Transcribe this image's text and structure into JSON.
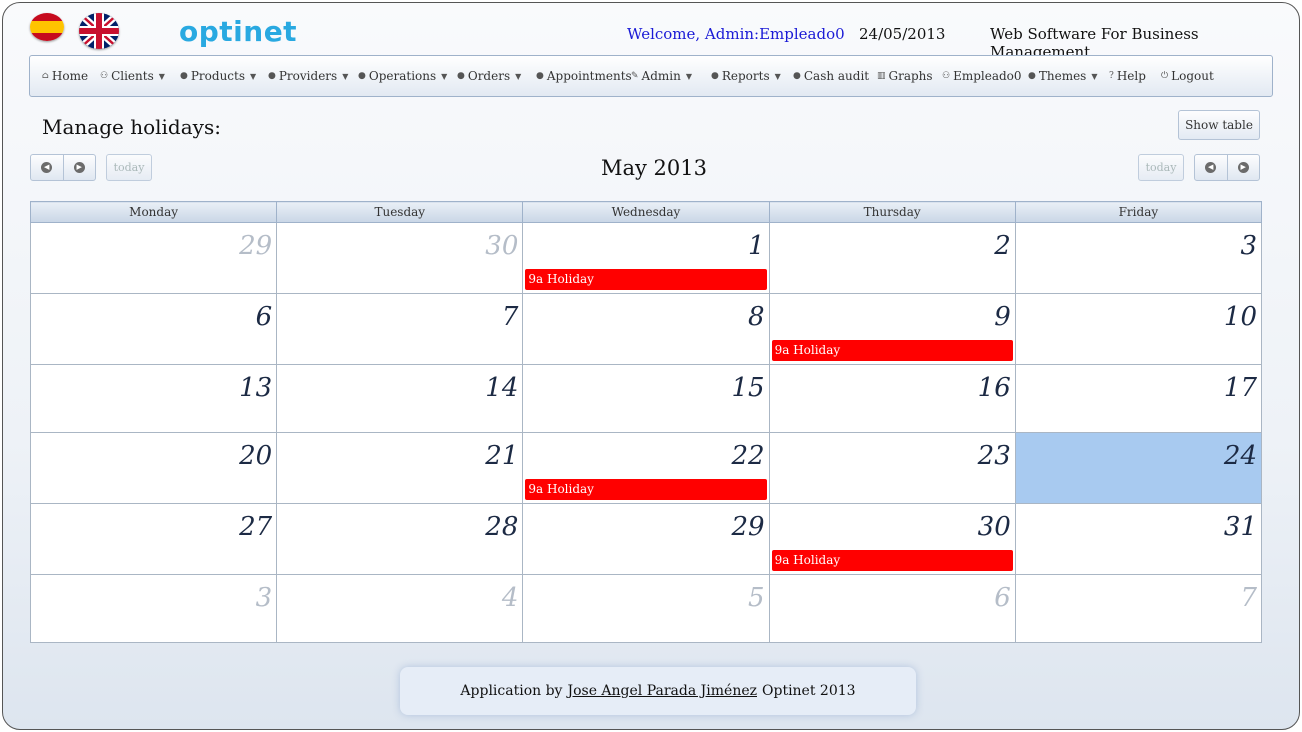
{
  "header": {
    "logo": "optinet",
    "welcome": "Welcome, Admin:Empleado0",
    "date": "24/05/2013",
    "tagline": "Web Software For Business Management."
  },
  "flags": {
    "es": "spain-flag-icon",
    "uk": "uk-flag-icon"
  },
  "menu": [
    {
      "label": "Home",
      "icon": "⌂",
      "caret": false
    },
    {
      "label": "Clients",
      "icon": "⚇",
      "caret": true
    },
    {
      "label": "Products",
      "icon": "●",
      "caret": true
    },
    {
      "label": "Providers",
      "icon": "●",
      "caret": true
    },
    {
      "label": "Operations",
      "icon": "●",
      "caret": true
    },
    {
      "label": "Orders",
      "icon": "●",
      "caret": true
    },
    {
      "label": "Appointments",
      "icon": "●",
      "caret": false
    },
    {
      "label": "Admin",
      "icon": "✎",
      "caret": true
    },
    {
      "label": "Reports",
      "icon": "●",
      "caret": true
    },
    {
      "label": "Cash audit",
      "icon": "●",
      "caret": false
    },
    {
      "label": "Graphs",
      "icon": "▥",
      "caret": false
    },
    {
      "label": "Empleado0",
      "icon": "⚇",
      "caret": false
    },
    {
      "label": "Themes",
      "icon": "●",
      "caret": true
    },
    {
      "label": "Help",
      "icon": "?",
      "caret": false
    },
    {
      "label": "Logout",
      "icon": "⏻",
      "caret": false
    }
  ],
  "page": {
    "title": "Manage holidays:",
    "show_table": "Show table",
    "today": "today",
    "month_title": "May 2013"
  },
  "calendar": {
    "weekdays": [
      "Monday",
      "Tuesday",
      "Wednesday",
      "Thursday",
      "Friday"
    ],
    "weeks": [
      [
        {
          "day": "29",
          "other": true
        },
        {
          "day": "30",
          "other": true
        },
        {
          "day": "1",
          "event": "9a Holiday"
        },
        {
          "day": "2"
        },
        {
          "day": "3"
        }
      ],
      [
        {
          "day": "6"
        },
        {
          "day": "7"
        },
        {
          "day": "8"
        },
        {
          "day": "9",
          "event": "9a Holiday"
        },
        {
          "day": "10"
        }
      ],
      [
        {
          "day": "13"
        },
        {
          "day": "14"
        },
        {
          "day": "15"
        },
        {
          "day": "16"
        },
        {
          "day": "17"
        }
      ],
      [
        {
          "day": "20"
        },
        {
          "day": "21"
        },
        {
          "day": "22",
          "event": "9a Holiday"
        },
        {
          "day": "23"
        },
        {
          "day": "24",
          "today": true
        }
      ],
      [
        {
          "day": "27"
        },
        {
          "day": "28"
        },
        {
          "day": "29"
        },
        {
          "day": "30",
          "event": "9a Holiday"
        },
        {
          "day": "31"
        }
      ],
      [
        {
          "day": "3",
          "other": true
        },
        {
          "day": "4",
          "other": true
        },
        {
          "day": "5",
          "other": true
        },
        {
          "day": "6",
          "other": true
        },
        {
          "day": "7",
          "other": true
        }
      ]
    ],
    "event_color": "#ff0000",
    "today_color": "#a8caf0"
  },
  "footer": {
    "prefix": "Application by",
    "author": "Jose Angel Parada Jiménez",
    "suffix": "Optinet 2013"
  }
}
